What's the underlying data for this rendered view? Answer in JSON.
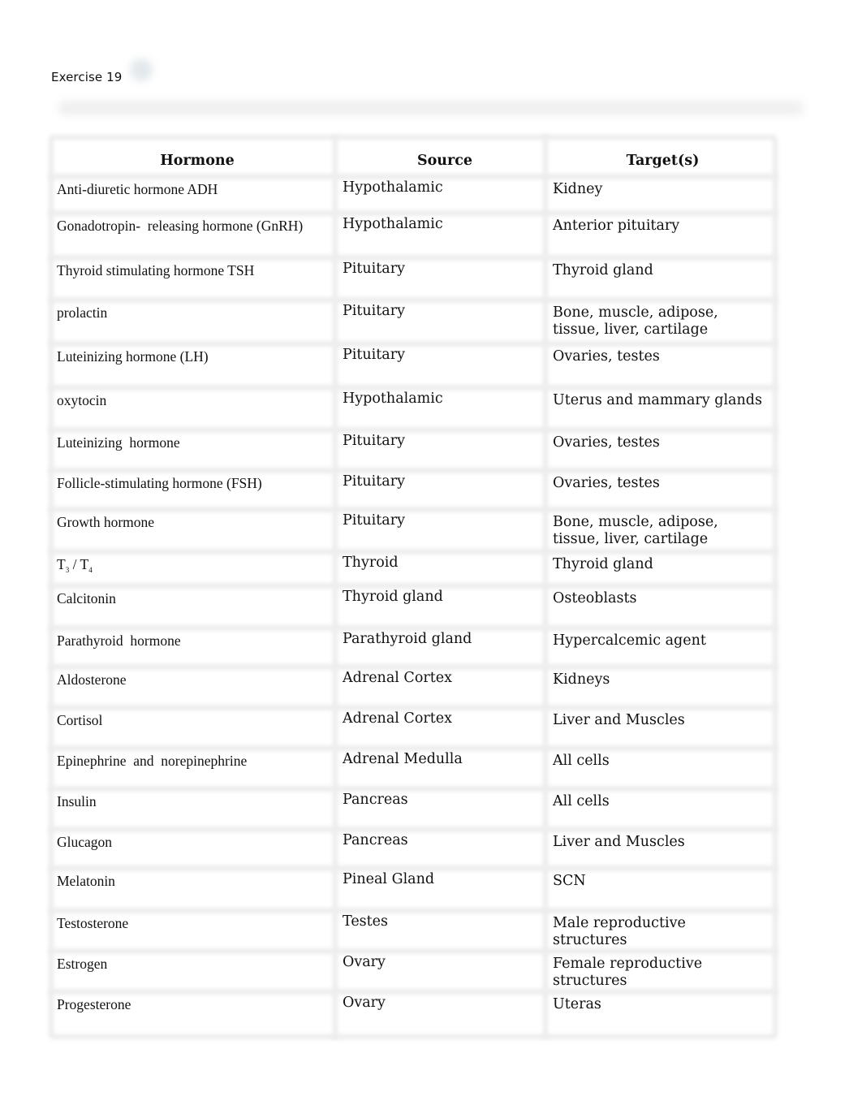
{
  "document": {
    "title": "Exercise 19"
  },
  "table": {
    "headers": {
      "hormone": "Hormone",
      "source": "Source",
      "target": "Target(s)"
    },
    "rows": [
      {
        "hormone": "Anti-diuretic hormone ADH",
        "source": "Hypothalamic",
        "target": "Kidney"
      },
      {
        "hormone": "Gonadotropin-  releasing hormone (GnRH)",
        "source": "Hypothalamic",
        "target": "Anterior pituitary"
      },
      {
        "hormone": "Thyroid stimulating hormone TSH",
        "source": "Pituitary",
        "target": "Thyroid gland"
      },
      {
        "hormone": "prolactin",
        "source": "Pituitary",
        "target": "Bone, muscle, adipose, tissue, liver, cartilage"
      },
      {
        "hormone": "Luteinizing hormone (LH)",
        "source": "Pituitary",
        "target": "Ovaries, testes"
      },
      {
        "hormone": "oxytocin",
        "source": "Hypothalamic",
        "target": "Uterus and mammary glands"
      },
      {
        "hormone": "Luteinizing  hormone",
        "source": "Pituitary",
        "target": "Ovaries, testes"
      },
      {
        "hormone": "Follicle-stimulating hormone (FSH)",
        "source": "Pituitary",
        "target": "Ovaries, testes"
      },
      {
        "hormone": "Growth hormone",
        "source": "Pituitary",
        "target": "Bone, muscle, adipose, tissue, liver, cartilage"
      },
      {
        "hormone_parts": {
          "a": "T",
          "a_sub": "3",
          "sep": " / T",
          "b_sub": "4"
        },
        "source": "Thyroid",
        "target": "Thyroid gland"
      },
      {
        "hormone": "Calcitonin",
        "source": "Thyroid gland",
        "target": "Osteoblasts"
      },
      {
        "hormone": "Parathyroid  hormone",
        "source": "Parathyroid gland",
        "target": "Hypercalcemic agent"
      },
      {
        "hormone": "Aldosterone",
        "source": "Adrenal Cortex",
        "target": "Kidneys"
      },
      {
        "hormone": "Cortisol",
        "source": "Adrenal Cortex",
        "target": "Liver and Muscles"
      },
      {
        "hormone": "Epinephrine  and  norepinephrine",
        "source": "Adrenal Medulla",
        "target": "All cells"
      },
      {
        "hormone": "Insulin",
        "source": "Pancreas",
        "target": "All cells"
      },
      {
        "hormone": "Glucagon",
        "source": "Pancreas",
        "target": "Liver and Muscles"
      },
      {
        "hormone": "Melatonin",
        "source": "Pineal Gland",
        "target": "SCN"
      },
      {
        "hormone": "Testosterone",
        "source": "Testes",
        "target": "Male reproductive structures"
      },
      {
        "hormone": "Estrogen",
        "source": "Ovary",
        "target": "Female reproductive structures"
      },
      {
        "hormone": "Progesterone",
        "source": "Ovary",
        "target": "Uteras"
      }
    ]
  }
}
